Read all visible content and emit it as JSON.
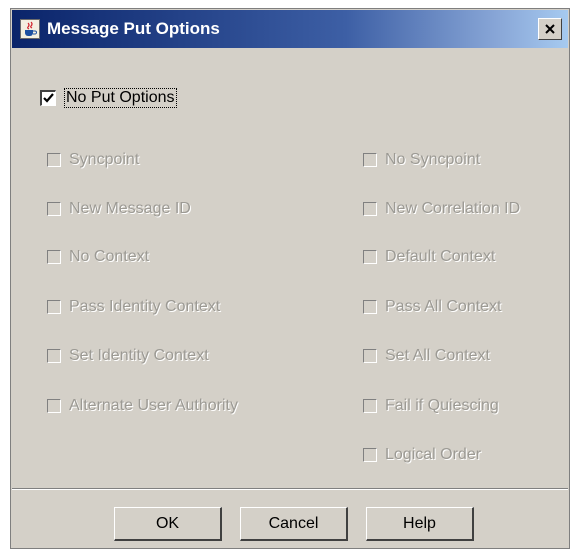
{
  "window": {
    "title": "Message Put Options",
    "icon": "java-cup-icon",
    "close_glyph": "✕"
  },
  "main_option": {
    "label": "No Put Options",
    "checked": true
  },
  "options_left": [
    {
      "label": "Syncpoint",
      "checked": false,
      "enabled": false
    },
    {
      "label": "New Message ID",
      "checked": false,
      "enabled": false
    },
    {
      "label": "No Context",
      "checked": false,
      "enabled": false
    },
    {
      "label": "Pass Identity Context",
      "checked": false,
      "enabled": false
    },
    {
      "label": "Set Identity Context",
      "checked": false,
      "enabled": false
    },
    {
      "label": "Alternate User Authority",
      "checked": false,
      "enabled": false
    }
  ],
  "options_right": [
    {
      "label": "No Syncpoint",
      "checked": false,
      "enabled": false
    },
    {
      "label": "New Correlation ID",
      "checked": false,
      "enabled": false
    },
    {
      "label": "Default Context",
      "checked": false,
      "enabled": false
    },
    {
      "label": "Pass All Context",
      "checked": false,
      "enabled": false
    },
    {
      "label": "Set All Context",
      "checked": false,
      "enabled": false
    },
    {
      "label": "Fail if Quiescing",
      "checked": false,
      "enabled": false
    },
    {
      "label": "Logical Order",
      "checked": false,
      "enabled": false
    }
  ],
  "buttons": {
    "ok_label": "OK",
    "cancel_label": "Cancel",
    "help_label": "Help"
  },
  "colors": {
    "title_gradient_start": "#0a246a",
    "title_gradient_end": "#a6caf0",
    "dialog_background": "#d4d0c8",
    "disabled_text": "#9c9a94"
  }
}
